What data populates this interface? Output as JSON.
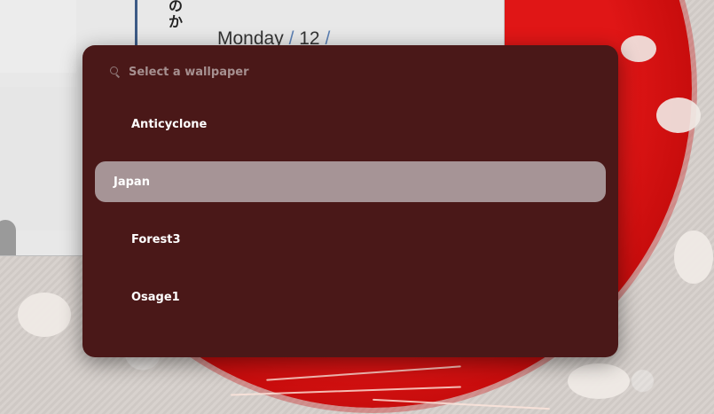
{
  "background_window": {
    "jp_text_line1": "の",
    "jp_text_line2": "か",
    "date_weekday": "Monday",
    "date_sep1": "/",
    "date_day": "12",
    "date_sep2": "/"
  },
  "picker": {
    "search_placeholder": "Select a wallpaper",
    "search_value": "",
    "items": [
      {
        "label": "Anticyclone",
        "selected": false
      },
      {
        "label": "Japan",
        "selected": true
      },
      {
        "label": "Forest3",
        "selected": false
      },
      {
        "label": "Osage1",
        "selected": false
      }
    ]
  },
  "colors": {
    "picker_bg": "#4a1818",
    "selected_bg": "#a69496",
    "sun_red": "#e01616"
  }
}
